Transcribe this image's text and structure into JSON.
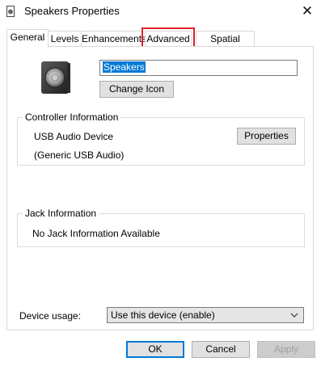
{
  "window": {
    "title": "Speakers Properties",
    "close_glyph": "✕"
  },
  "tabs": [
    {
      "label": "General",
      "active": true
    },
    {
      "label": "Levels",
      "active": false
    },
    {
      "label": "Enhancements",
      "active": false
    },
    {
      "label": "Advanced",
      "active": false,
      "highlighted": true
    },
    {
      "label": "Spatial sound",
      "active": false
    }
  ],
  "general": {
    "device_name": "Speakers",
    "change_icon_label": "Change Icon",
    "controller": {
      "group_label": "Controller Information",
      "device": "USB Audio Device",
      "driver": "(Generic USB Audio)",
      "properties_label": "Properties"
    },
    "jack": {
      "group_label": "Jack Information",
      "text": "No Jack Information Available"
    },
    "device_usage": {
      "label": "Device usage:",
      "selected": "Use this device (enable)"
    }
  },
  "footer": {
    "ok_label": "OK",
    "cancel_label": "Cancel",
    "apply_label": "Apply"
  },
  "colors": {
    "highlight_box": "#e0202a",
    "selection": "#0078d7"
  },
  "icons": {
    "title": "speaker-icon",
    "device": "speaker-device-icon",
    "close": "close-icon",
    "dropdown": "chevron-down-icon"
  }
}
